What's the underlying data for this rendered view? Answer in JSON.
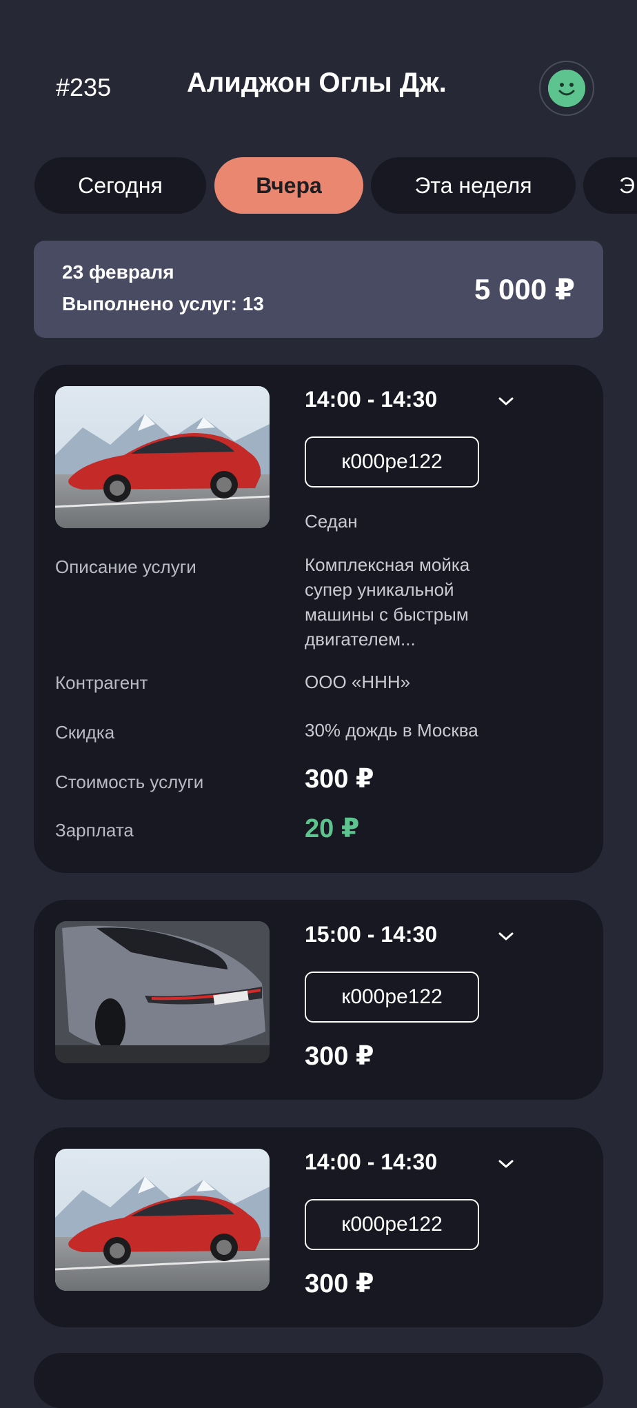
{
  "header": {
    "order_number": "#235",
    "user_name": "Алиджон Оглы Дж.",
    "avatar_icon": "smiley-face-icon",
    "avatar_color": "#5ec48f"
  },
  "tabs": [
    {
      "label": "Сегодня",
      "active": false
    },
    {
      "label": "Вчера",
      "active": true
    },
    {
      "label": "Эта неделя",
      "active": false
    },
    {
      "label": "Э",
      "active": false
    }
  ],
  "summary": {
    "date": "23 февраля",
    "services_done": "Выполнено услуг: 13",
    "total": "5 000 ₽"
  },
  "cards": [
    {
      "image": "red-sedan-photo",
      "time": "14:00 - 14:30",
      "plate": "к000ре122",
      "car_type": "Седан",
      "labels": {
        "description": "Описание услуги",
        "contractor": "Контрагент",
        "discount": "Скидка",
        "cost": "Стоимость услуги",
        "salary": "Зарплата"
      },
      "description": "Комплексная мойка супер уникальной машины с быстрым двигателем...",
      "contractor": "ООО «ННН»",
      "discount": "30% дождь в Москва",
      "cost": "300 ₽",
      "salary": "20 ₽"
    },
    {
      "image": "grey-sedan-rear-photo",
      "time": "15:00 - 14:30",
      "plate": "к000ре122",
      "price": "300 ₽"
    },
    {
      "image": "red-sedan-photo",
      "time": "14:00 - 14:30",
      "plate": "к000ре122",
      "price": "300 ₽"
    }
  ],
  "colors": {
    "background": "#262935",
    "card": "#171821",
    "summary": "#484b61",
    "accent": "#e98771",
    "salary_green": "#5ec48f"
  }
}
